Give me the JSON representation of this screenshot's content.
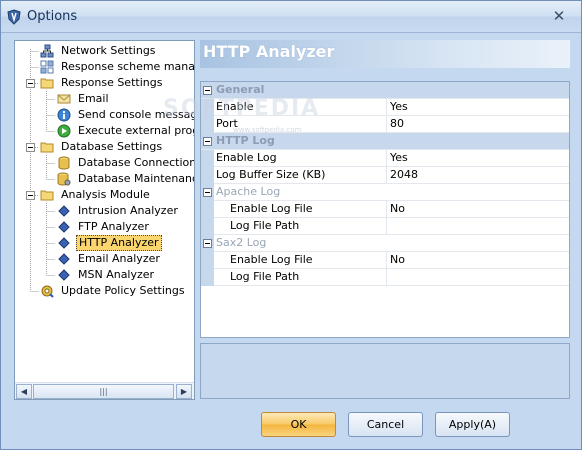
{
  "window": {
    "title": "Options"
  },
  "tree": {
    "items": [
      {
        "label": "Network Settings"
      },
      {
        "label": "Response scheme manage"
      },
      {
        "label": "Response Settings"
      },
      {
        "label": "Email"
      },
      {
        "label": "Send console message"
      },
      {
        "label": "Execute external progra"
      },
      {
        "label": "Database Settings"
      },
      {
        "label": "Database Connection"
      },
      {
        "label": "Database Maintenance"
      },
      {
        "label": "Analysis Module"
      },
      {
        "label": "Intrusion Analyzer"
      },
      {
        "label": "FTP Analyzer"
      },
      {
        "label": "HTTP Analyzer"
      },
      {
        "label": "Email Analyzer"
      },
      {
        "label": "MSN Analyzer"
      },
      {
        "label": "Update Policy Settings"
      }
    ],
    "selected": "HTTP Analyzer"
  },
  "header": {
    "title": "HTTP Analyzer"
  },
  "grid": {
    "rows": [
      {
        "name": "General",
        "value": ""
      },
      {
        "name": "Enable",
        "value": "Yes"
      },
      {
        "name": "Port",
        "value": "80"
      },
      {
        "name": "HTTP Log",
        "value": ""
      },
      {
        "name": "Enable Log",
        "value": "Yes"
      },
      {
        "name": "Log Buffer Size (KB)",
        "value": "2048"
      },
      {
        "name": "Apache Log",
        "value": ""
      },
      {
        "name": "Enable Log File",
        "value": "No"
      },
      {
        "name": "Log File Path",
        "value": ""
      },
      {
        "name": "Sax2 Log",
        "value": ""
      },
      {
        "name": "Enable Log File",
        "value": "No"
      },
      {
        "name": "Log File Path",
        "value": ""
      }
    ]
  },
  "watermark": {
    "text": "SOFTPEDIA",
    "sub": "www.softpedia.com"
  },
  "buttons": {
    "ok": "OK",
    "cancel": "Cancel",
    "apply": "Apply(A)"
  },
  "colors": {
    "selection": "#fbd66e",
    "ok_button": "#f8c864",
    "header_gradient": "#a8c3e2"
  }
}
